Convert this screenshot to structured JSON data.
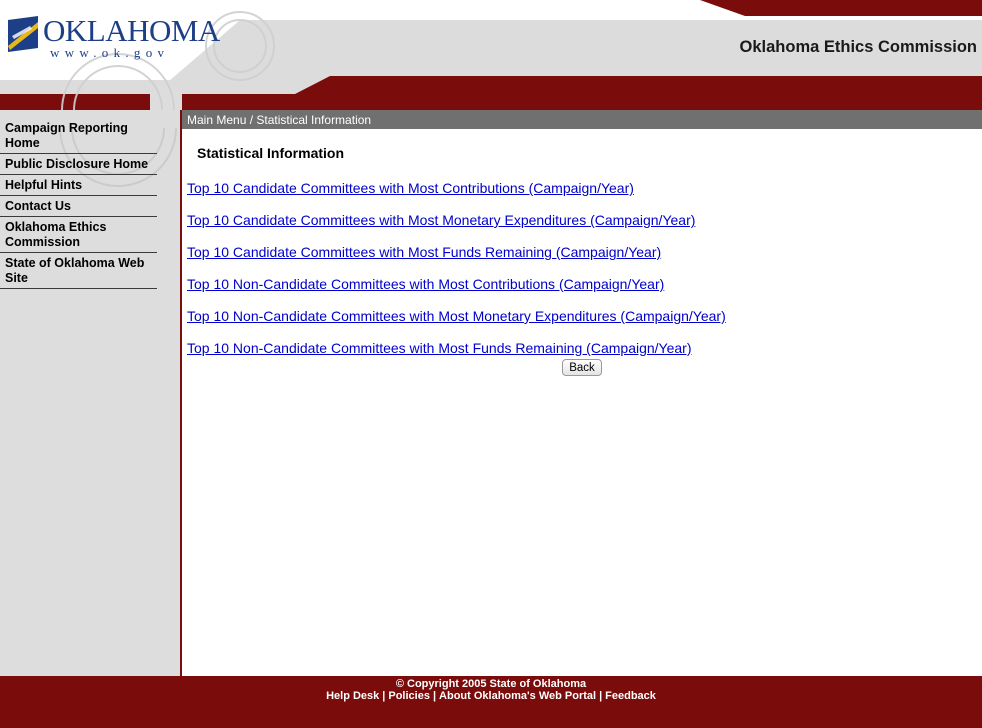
{
  "header": {
    "logo": {
      "word": "OKLAHOMA",
      "url": "www.ok.gov"
    },
    "site_title": "Oklahoma Ethics Commission",
    "colors": {
      "maroon": "#7a0c0c",
      "logo_blue": "#1d3f87",
      "logo_gold": "#e8b81a"
    }
  },
  "sidebar": {
    "items": [
      {
        "label": "Campaign Reporting Home"
      },
      {
        "label": "Public Disclosure Home"
      },
      {
        "label": "Helpful Hints"
      },
      {
        "label": "Contact Us"
      },
      {
        "label": "Oklahoma Ethics Commission"
      },
      {
        "label": "State of Oklahoma Web Site"
      }
    ]
  },
  "main": {
    "breadcrumb": "Main Menu / Statistical Information",
    "title": "Statistical Information",
    "links": [
      {
        "label": "Top 10 Candidate Committees with Most Contributions (Campaign/Year)"
      },
      {
        "label": "Top 10 Candidate Committees with Most Monetary Expenditures (Campaign/Year)"
      },
      {
        "label": "Top 10 Candidate Committees with Most Funds Remaining (Campaign/Year)"
      },
      {
        "label": "Top 10 Non-Candidate Committees with Most Contributions (Campaign/Year)"
      },
      {
        "label": "Top 10 Non-Candidate Committees with Most Monetary Expenditures (Campaign/Year)"
      },
      {
        "label": "Top 10 Non-Candidate Committees with Most Funds Remaining (Campaign/Year)"
      }
    ],
    "back_label": "Back"
  },
  "footer": {
    "copyright": "© Copyright 2005 State of Oklahoma",
    "links": [
      {
        "label": "Help Desk"
      },
      {
        "label": "Policies"
      },
      {
        "label": "About Oklahoma's Web Portal"
      },
      {
        "label": "Feedback"
      }
    ],
    "separator": "|"
  }
}
